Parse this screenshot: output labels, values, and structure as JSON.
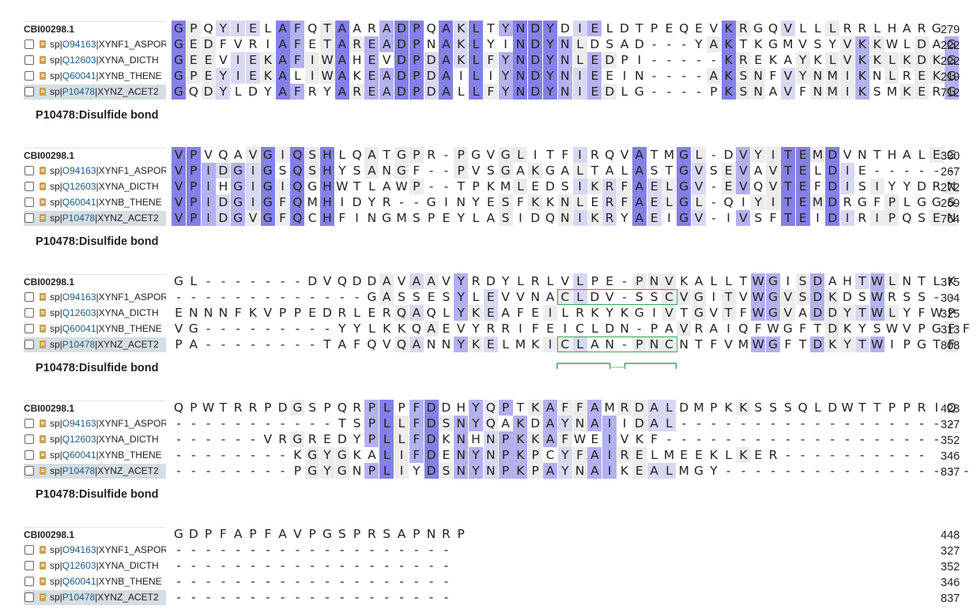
{
  "alignment": {
    "reference": "CBI00298.1",
    "sequences": [
      {
        "prefix": "sp|",
        "accession": "O94163",
        "suffix": "|XYNF1_ASPOR",
        "highlighted": false
      },
      {
        "prefix": "sp|",
        "accession": "Q12603",
        "suffix": "|XYNA_DICTH",
        "highlighted": false
      },
      {
        "prefix": "sp|",
        "accession": "Q60041",
        "suffix": "|XYNB_THENE",
        "highlighted": false
      },
      {
        "prefix": "sp|",
        "accession": "P10478",
        "suffix": "|XYNZ_ACET2",
        "highlighted": true
      }
    ],
    "feature_label": "P10478:Disulfide bond",
    "feature_color": "#3aa35a",
    "conservation_colors": [
      "#ececec",
      "#d8d8f2",
      "#b3b1ee",
      "#8480e6"
    ],
    "blocks": [
      {
        "rows": [
          "GPQYIELAFQTAARADPQAKLTYNDYDIELDTPEQEVKRGQVLLLRRLHARG",
          "GEDFVRIAFETAREADPNAKLYINDYNLDSAD---YAKTKGMVSYVKKWLDAG",
          "GEEVIEKAFIWAHEVDPDAKLFYNDYNLEDPI-----KREKAYKLVKKLKDKG",
          "GPEYIEKALIWAKEADPDAILIYNDYNIEEIN----AKSNFVYNMIKNLREKG",
          "GQDYLDYAFRYAREADPDALLFYNDYNIEDLG----PKSNAVFNMIKSMKERG"
        ],
        "ends": [
          "279",
          "222",
          "222",
          "219",
          "712"
        ],
        "show_feature_label": true
      },
      {
        "rows": [
          "VPVQAVGIQSHLQATGPR-PGVGLITFIRQVATMGL-DVYITEMDVNTHALEG",
          "VPIDGIGSQSHYSANGF--PVSGAKGALTALASTGVSEVAVTELDIE------",
          "VPIHGIGIQGHWTLAWP--TPKMLEDSIKRFAELGV-EVQVTEFDISIYYDRN",
          "VPIDGIGFQMHIDYR--GINYESFKKNLERFAELGL-QIYITEMDRGFPLGGS",
          "VPIDGVGFQCHFINGMSPEYLASIDQNIKRYAEIGV-IVSFTEIDIRIPQSEN"
        ],
        "ends": [
          "330",
          "267",
          "272",
          "269",
          "764"
        ],
        "show_feature_label": true
      },
      {
        "rows": [
          "GL-------DVQDDAVAAVYRDYLRLVLPE-PNVKALLTWGISDAHTWLNTLK",
          "-------------GASSESYLEVVNACLDV-SSCVGITVWGVSDKDSWRSS--",
          "ENNNFKVPPEDRLERQAQLYKEAFEILRKYKGIVTGVTFWGVADDYTWLYFWP",
          "VG---------YYLKKQAEVYRRIFEICLDN-PAVRAIQFWGFTDKYSWVPGFF",
          "PA--------TAFQVQANNYKELMKICLAN-PNCNTFVMWGFTDKYTWIPGTF"
        ],
        "ends": [
          "375",
          "304",
          "325",
          "313",
          "808"
        ],
        "show_feature_label": true
      },
      {
        "rows": [
          "QPWTRRPDGSPQRPLPFDDHYQPTKAFFAMRDALDMPKKSSSQLDWTTPPRIQ",
          "-----------TSPLLFDSNYQAKDAYNAIIDAL-------------------",
          "------VRGREDYPLLFDKNHNPKKAFWEIVKF-------------------",
          "--------KGYGKALIFDENYNPKPCYFAIRELMEEKLKER----------",
          "--------PGYGNPLIYDSNYNPKPAYNAIKEALMGY-----------------"
        ],
        "ends": [
          "428",
          "327",
          "352",
          "346",
          "837"
        ],
        "show_feature_label": true
      },
      {
        "rows": [
          "GDPFAPFAVPGSPRSAPNRP",
          "-------------------",
          "-------------------",
          "-------------------",
          "-------------------"
        ],
        "ends": [
          "448",
          "327",
          "352",
          "346",
          "837"
        ],
        "show_feature_label": false
      }
    ]
  }
}
